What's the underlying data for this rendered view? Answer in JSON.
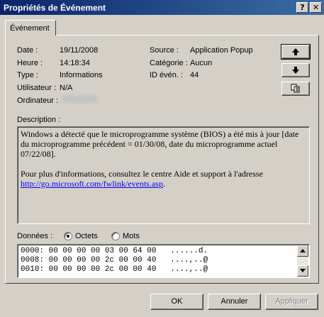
{
  "window": {
    "title": "Propriétés de Événement",
    "help_button": "?",
    "close_button": "✕"
  },
  "tabs": [
    {
      "label": "Événement"
    }
  ],
  "event": {
    "date_label": "Date :",
    "date_value": "19/11/2008",
    "time_label": "Heure :",
    "time_value": "14:18:34",
    "type_label": "Type :",
    "type_value": "Informations",
    "user_label": "Utilisateur :",
    "user_value": "N/A",
    "computer_label": "Ordinateur :",
    "source_label": "Source :",
    "source_value": "Application Popup",
    "category_label": "Catégorie :",
    "category_value": "Aucun",
    "event_id_label": "ID évén. :",
    "event_id_value": "44"
  },
  "nav_buttons": {
    "up_icon": "arrow-up-icon",
    "down_icon": "arrow-down-icon",
    "copy_icon": "copy-icon"
  },
  "description": {
    "label": "Description :",
    "line1": "Windows a détecté que le microprogramme système (BIOS) a été mis à jour [date du microprogramme précédent = 01/30/08, date du microprogramme actuel 07/22/08].",
    "line2": "Pour plus d'informations, consultez le centre Aide et support à l'adresse",
    "link": "http://go.microsoft.com/fwlink/events.asp",
    "link_suffix": "."
  },
  "data_section": {
    "label": "Données :",
    "option_bytes": "Octets",
    "option_words": "Mots",
    "selected": "Octets",
    "rows": [
      "0000: 00 00 00 00 03 00 64 00   ......d.",
      "0008: 00 00 00 00 2c 00 00 40   ....,..@",
      "0010: 00 00 00 00 2c 00 00 40   ....,..@"
    ]
  },
  "footer": {
    "ok": "OK",
    "cancel": "Annuler",
    "apply": "Appliquer"
  }
}
